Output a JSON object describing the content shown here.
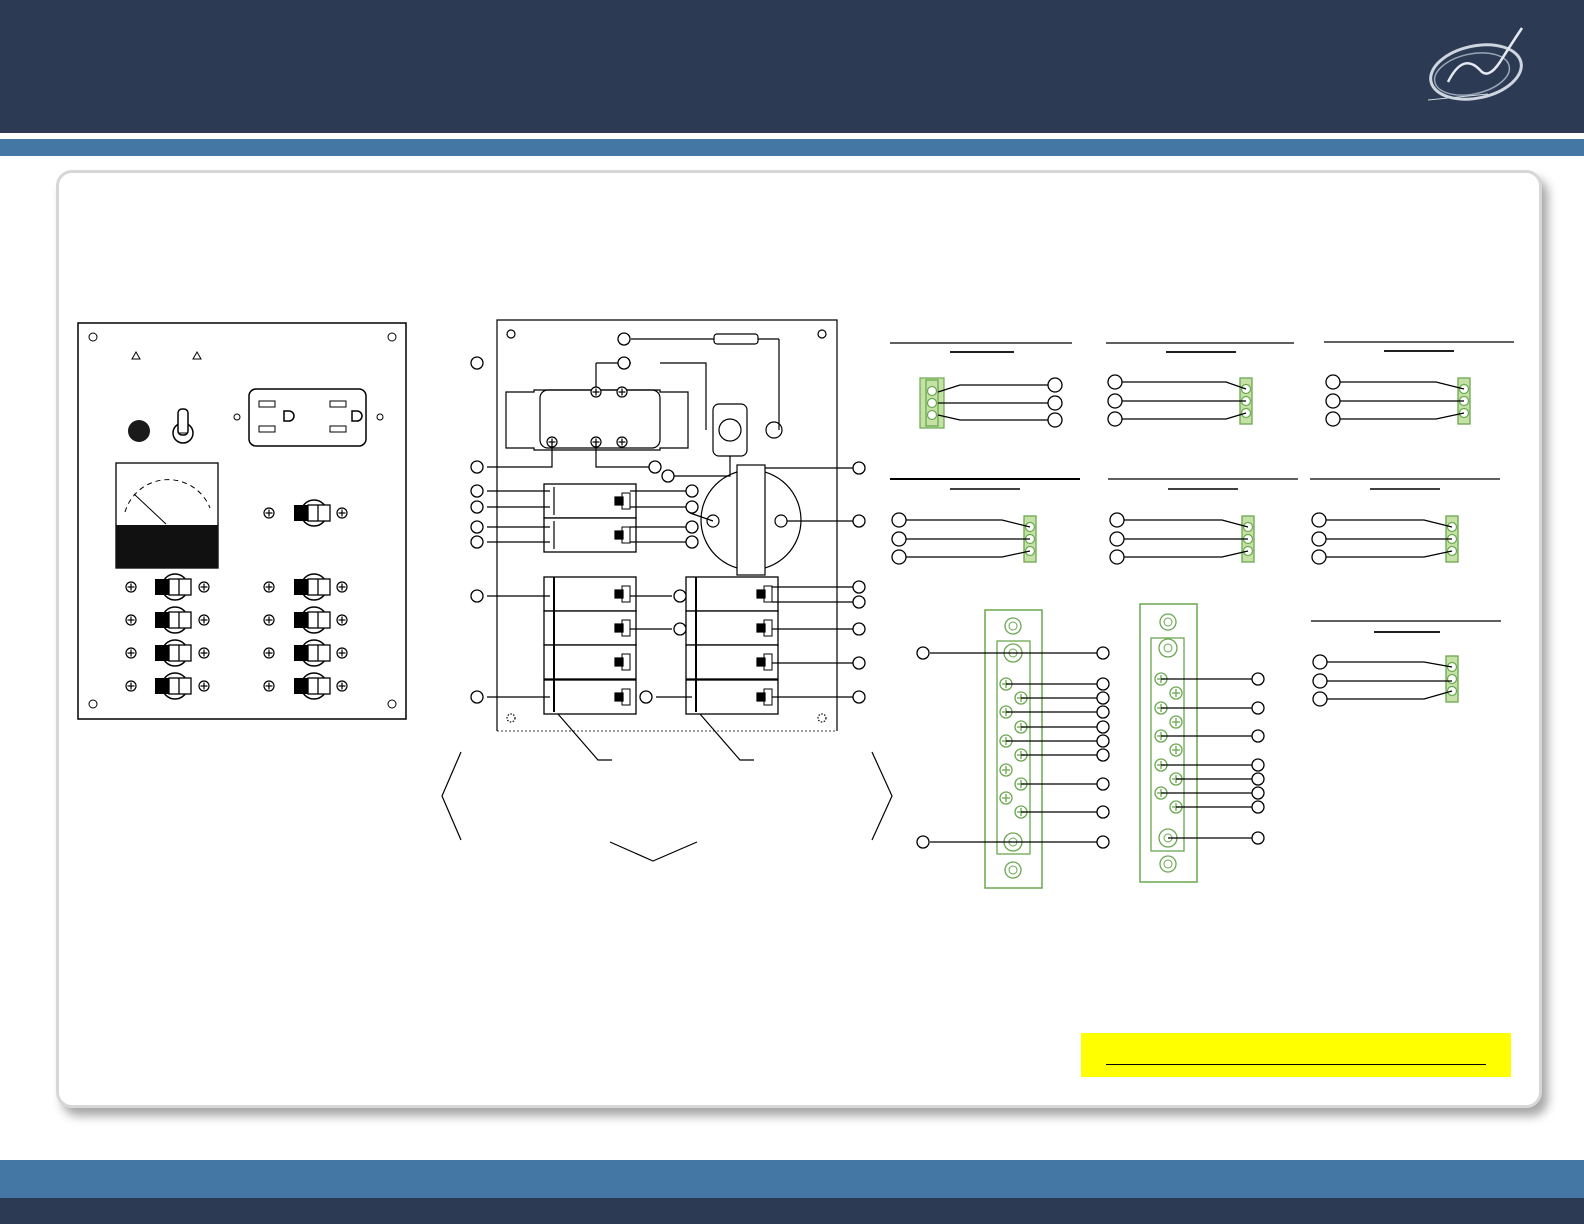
{
  "colors": {
    "navy": "#2c3a53",
    "blue": "#4577a5",
    "connector_green": "#8bc34a",
    "note_yellow": "#ffff00",
    "meter_face_dark": "#111111"
  },
  "icons": {
    "logo": "signature-logo-icon",
    "warning": "warning-triangle-icon",
    "screw": "screw-head-icon",
    "breaker": "circuit-breaker-icon",
    "outlet": "duplex-outlet-icon",
    "terminal": "wire-terminal-circle-icon"
  },
  "panel": {
    "breaker_rows": 4,
    "meter_scale": "analog"
  },
  "connectors": {
    "count": 7,
    "pins_each": 3
  },
  "terminal_strips": {
    "left_positions": 7,
    "right_positions": 7
  },
  "note": {
    "text": ""
  }
}
